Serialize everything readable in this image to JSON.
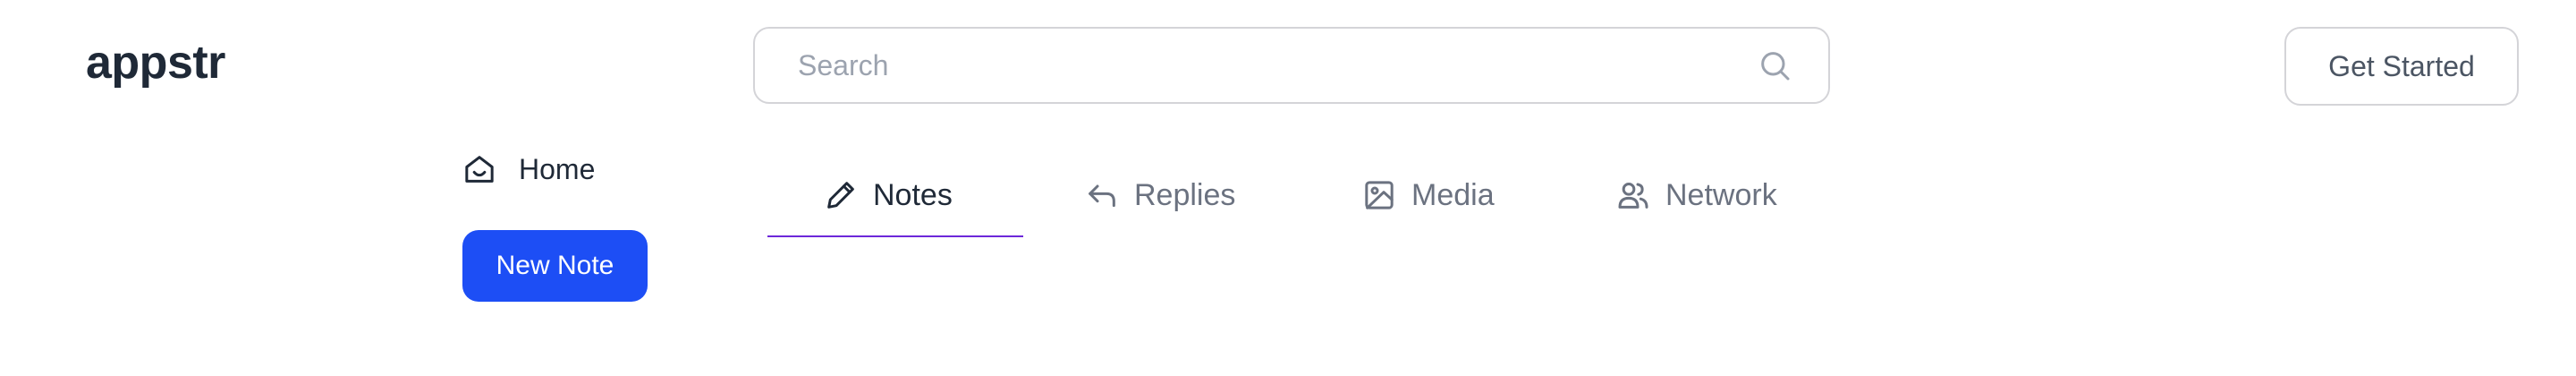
{
  "header": {
    "logo": "appstr",
    "search": {
      "placeholder": "Search",
      "value": ""
    },
    "cta_label": "Get Started"
  },
  "sidebar": {
    "items": [
      {
        "label": "Home",
        "icon": "home-icon"
      }
    ],
    "new_note_label": "New Note",
    "new_note_color": "#1d4ef5"
  },
  "tabs": [
    {
      "label": "Notes",
      "icon": "pencil-icon",
      "active": true
    },
    {
      "label": "Replies",
      "icon": "reply-icon",
      "active": false
    },
    {
      "label": "Media",
      "icon": "image-icon",
      "active": false
    },
    {
      "label": "Network",
      "icon": "users-icon",
      "active": false
    }
  ],
  "colors": {
    "accent_underline": "#6d28d9",
    "text_dark": "#1f2937",
    "text_muted": "#6b7280"
  }
}
